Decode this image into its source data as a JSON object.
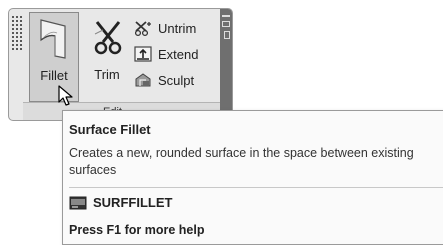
{
  "ribbon": {
    "fillet": {
      "label": "Fillet",
      "icon": "surface-fillet-icon"
    },
    "trim": {
      "label": "Trim",
      "icon": "scissors-icon"
    },
    "tools": [
      {
        "label": "Untrim",
        "icon": "untrim-icon"
      },
      {
        "label": "Extend",
        "icon": "extend-icon"
      },
      {
        "label": "Sculpt",
        "icon": "sculpt-icon"
      }
    ],
    "panel_title": "Edit"
  },
  "tooltip": {
    "title": "Surface Fillet",
    "description": "Creates a new, rounded surface in the space between existing\nsurfaces",
    "command": "SURFFILLET",
    "help": "Press F1 for more help"
  },
  "colors": {
    "panel_bg": "#e8e8e8",
    "selected_bg": "#cfcfcf",
    "strip": "#6f6f6f",
    "tooltip_bg": "#fafafa"
  }
}
